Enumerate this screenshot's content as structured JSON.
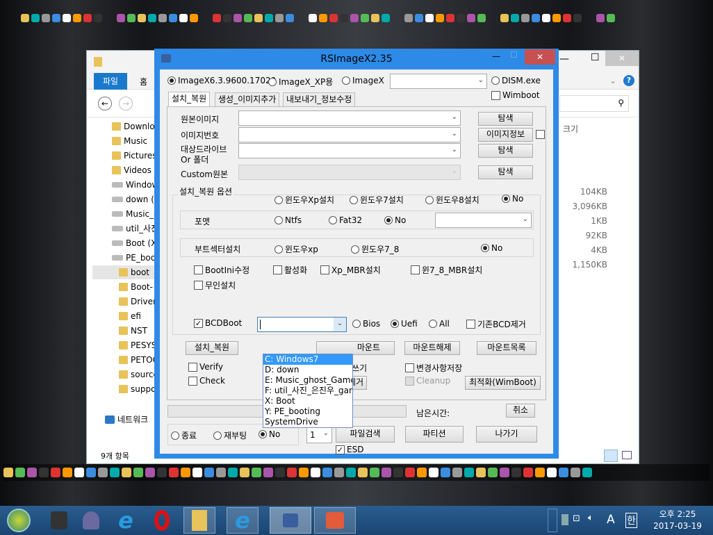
{
  "explorer": {
    "ribbon_tabs": [
      "파일",
      "홈"
    ],
    "nav_items": [
      {
        "label": "Downlo",
        "type": "folder"
      },
      {
        "label": "Music",
        "type": "folder"
      },
      {
        "label": "Pictures",
        "type": "folder"
      },
      {
        "label": "Videos",
        "type": "folder"
      },
      {
        "label": "Window",
        "type": "drive"
      },
      {
        "label": "down (D",
        "type": "drive"
      },
      {
        "label": "Music_g",
        "type": "drive"
      },
      {
        "label": "util_사진",
        "type": "drive"
      },
      {
        "label": "Boot (X",
        "type": "drive"
      },
      {
        "label": "PE_boot",
        "type": "drive"
      },
      {
        "label": "boot",
        "type": "subfolder",
        "selected": true
      },
      {
        "label": "Boot-",
        "type": "subfolder"
      },
      {
        "label": "Driver",
        "type": "subfolder"
      },
      {
        "label": "efi",
        "type": "subfolder"
      },
      {
        "label": "NST",
        "type": "subfolder"
      },
      {
        "label": "PESYS",
        "type": "subfolder"
      },
      {
        "label": "PETOO",
        "type": "subfolder"
      },
      {
        "label": "source",
        "type": "subfolder"
      },
      {
        "label": "suppo",
        "type": "subfolder"
      }
    ],
    "network": "네트워크",
    "size_header": "크기",
    "sizes": [
      "104KB",
      "3,096KB",
      "1KB",
      "92KB",
      "4KB",
      "1,150KB"
    ],
    "status": "9개 항목"
  },
  "dialog": {
    "title": "RSImageX2.35",
    "engine_options": [
      {
        "label": "ImageX6.3.9600.17029",
        "checked": true
      },
      {
        "label": "ImageX_XP용",
        "checked": false
      },
      {
        "label": "ImageX",
        "checked": false
      },
      {
        "label": "DISM.exe",
        "checked": false
      }
    ],
    "wimboot": "Wimboot",
    "tabs": [
      "설치_복원",
      "생성_이미지추가",
      "내보내기_정보수정"
    ],
    "fields": {
      "source": "원본이미지",
      "index": "이미지번호",
      "target1": "대상드라이브",
      "target2": "Or 폴더",
      "custom": "Custom원본"
    },
    "buttons": {
      "browse": "탐색",
      "imageinfo": "이미지정보",
      "install": "설치_복원",
      "mount": "마운트",
      "unmount": "마운트해제",
      "mountlist": "마운트목록",
      "optimize": "최적화(WimBoot)",
      "cancel": "취소",
      "filesearch": "파일검색",
      "partition": "파티션",
      "exit": "나가기",
      "remove": "제거"
    },
    "options_group": "설치_복원 옵션",
    "install_radios": [
      {
        "label": "윈도우Xp설치",
        "checked": false
      },
      {
        "label": "윈도우7설치",
        "checked": false
      },
      {
        "label": "윈도우8설치",
        "checked": false
      },
      {
        "label": "No",
        "checked": true
      }
    ],
    "format_label": "포맷",
    "format_radios": [
      {
        "label": "Ntfs",
        "checked": false
      },
      {
        "label": "Fat32",
        "checked": false
      },
      {
        "label": "No",
        "checked": true
      }
    ],
    "bootsector_label": "부트섹터설치",
    "bootsector_radios": [
      {
        "label": "윈도우xp",
        "checked": false
      },
      {
        "label": "윈도우7_8",
        "checked": false
      },
      {
        "label": "No",
        "checked": true
      }
    ],
    "checks": {
      "bootini": "BootIni수정",
      "activate": "활성화",
      "xpmbr": "Xp_MBR설치",
      "w78mbr": "윈7_8_MBR설치",
      "unattend": "무인설치",
      "bcdboot": "BCDBoot",
      "removebcd": "기존BCD제거",
      "verify": "Verify",
      "check": "Check",
      "readwrite": "읽기_쓰기",
      "savechanges": "변경사항저장",
      "cleanup": "Cleanup",
      "esd": "ESD"
    },
    "bcd_radios": [
      {
        "label": "Bios",
        "checked": false
      },
      {
        "label": "Uefi",
        "checked": true
      },
      {
        "label": "All",
        "checked": false
      }
    ],
    "bcd_dropdown": [
      "C: Windows7",
      "D: down",
      "E: Music_ghost_Game",
      "F: util_사진_은진우_game",
      "X: Boot",
      "Y: PE_booting",
      "SystemDrive"
    ],
    "progress": {
      "value": 0,
      "text": "0%"
    },
    "remaining": "남은시간:",
    "end_radios": [
      {
        "label": "종료",
        "checked": false
      },
      {
        "label": "재부팅",
        "checked": false
      },
      {
        "label": "No",
        "checked": true
      }
    ],
    "count_value": "1"
  },
  "taskbar": {
    "time": "오후 2:25",
    "date": "2017-03-19",
    "ime": "A",
    "lang": "한"
  }
}
